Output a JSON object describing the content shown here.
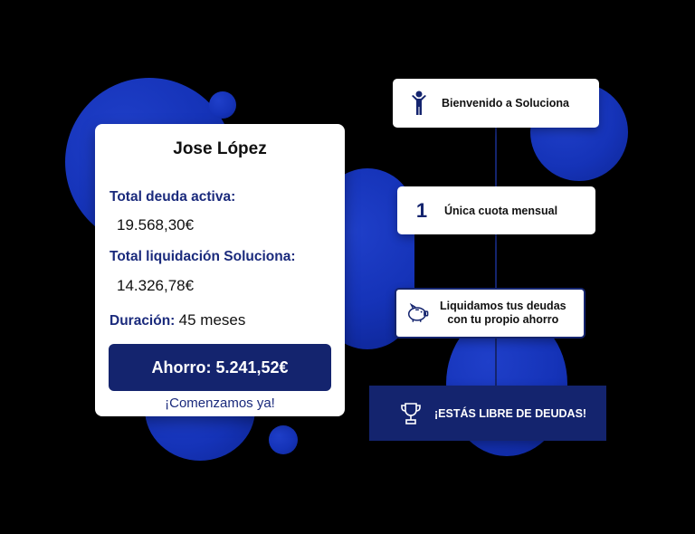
{
  "profile": {
    "name": "Jose López",
    "debt_label": "Total deuda activa:",
    "debt_value": "19.568,30€",
    "liquidation_label": "Total liquidación Soluciona:",
    "liquidation_value": "14.326,78€",
    "duration_label": "Duración:",
    "duration_value": "45 meses",
    "savings_button": "Ahorro: 5.241,52€",
    "start_link": "¡Comenzamos ya!"
  },
  "steps": [
    {
      "label": "Bienvenido a Soluciona",
      "icon": "person-icon"
    },
    {
      "label": "Única cuota mensual",
      "icon_text": "1"
    },
    {
      "label_line1": "Liquidamos tus deudas",
      "label_line2": "con tu propio ahorro",
      "icon": "piggy-bank-icon"
    },
    {
      "label": "¡ESTÁS LIBRE DE DEUDAS!",
      "icon": "trophy-icon"
    }
  ],
  "colors": {
    "accent_blue": "#1533b8",
    "navy": "#14246e",
    "label_blue": "#1a2a7c",
    "background": "#000000"
  }
}
